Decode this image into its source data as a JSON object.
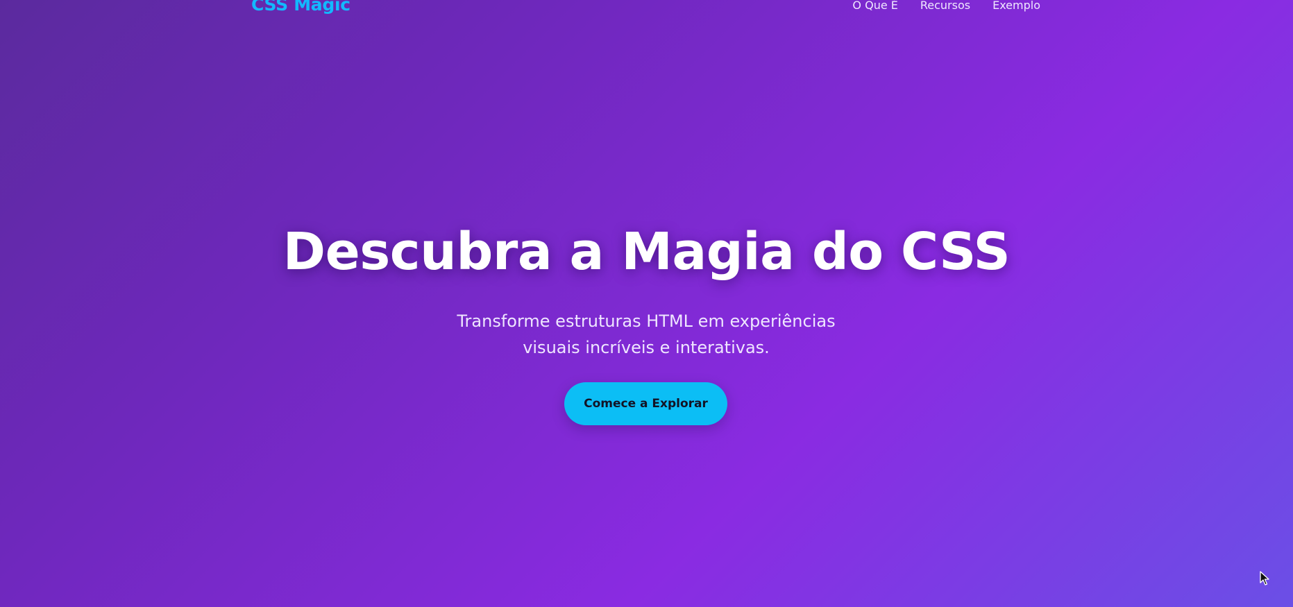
{
  "header": {
    "logo": "CSS Magic",
    "nav": [
      {
        "label": "O Que É"
      },
      {
        "label": "Recursos"
      },
      {
        "label": "Exemplo"
      }
    ]
  },
  "hero": {
    "title": "Descubra a Magia do CSS",
    "subtitle": "Transforme estruturas HTML em experiências visuais incríveis e interativas.",
    "cta_label": "Comece a Explorar"
  },
  "colors": {
    "accent": "#0cbef5",
    "background_start": "#5b2a9e",
    "background_mid": "#8a2be2",
    "background_end": "#6b4fe6",
    "logo": "#12b9ff"
  },
  "icons": {
    "cursor": "mouse-pointer-icon"
  }
}
